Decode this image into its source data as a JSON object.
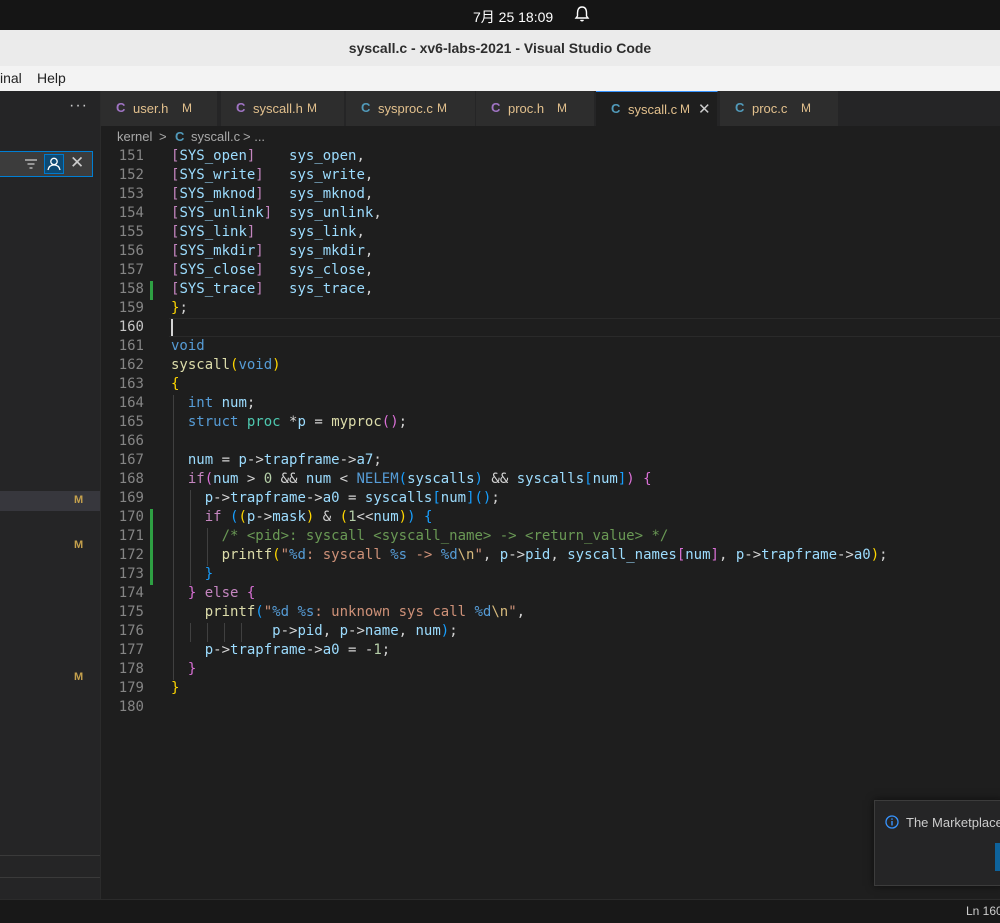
{
  "system_bar": {
    "clock": "7月 25  18:09"
  },
  "window": {
    "title": "syscall.c - xv6-labs-2021 - Visual Studio Code"
  },
  "menu": {
    "items": [
      "inal",
      "Help"
    ]
  },
  "sidebar": {
    "more_label": "···",
    "badges": [
      "M",
      "M",
      "M"
    ]
  },
  "tabs": [
    {
      "label": "user.h",
      "modified": "M",
      "icon": "C"
    },
    {
      "label": "syscall.h",
      "modified": "M",
      "icon": "C"
    },
    {
      "label": "sysproc.c",
      "modified": "M",
      "icon": "C"
    },
    {
      "label": "proc.h",
      "modified": "M",
      "icon": "C"
    },
    {
      "label": "syscall.c",
      "modified": "M",
      "icon": "C",
      "active": true,
      "close": "✕"
    },
    {
      "label": "proc.c",
      "modified": "M",
      "icon": "C"
    }
  ],
  "breadcrumb": {
    "folder": "kernel",
    "sep": ">",
    "icon": "C",
    "file": "syscall.c",
    "tail": "> ..."
  },
  "editor": {
    "line_numbers": [
      "151",
      "152",
      "153",
      "154",
      "155",
      "156",
      "157",
      "158",
      "159",
      "160",
      "161",
      "162",
      "163",
      "164",
      "165",
      "166",
      "167",
      "168",
      "169",
      "170",
      "171",
      "172",
      "173",
      "174",
      "175",
      "176",
      "177",
      "178",
      "179",
      "180"
    ],
    "current_line": "160"
  },
  "status_bar": {
    "position": "Ln 160"
  },
  "notification": {
    "message": "The Marketplace"
  },
  "colors": {
    "accent": "#007acc",
    "modified": "#e2c08d",
    "added_gutter": "#2ea043"
  }
}
